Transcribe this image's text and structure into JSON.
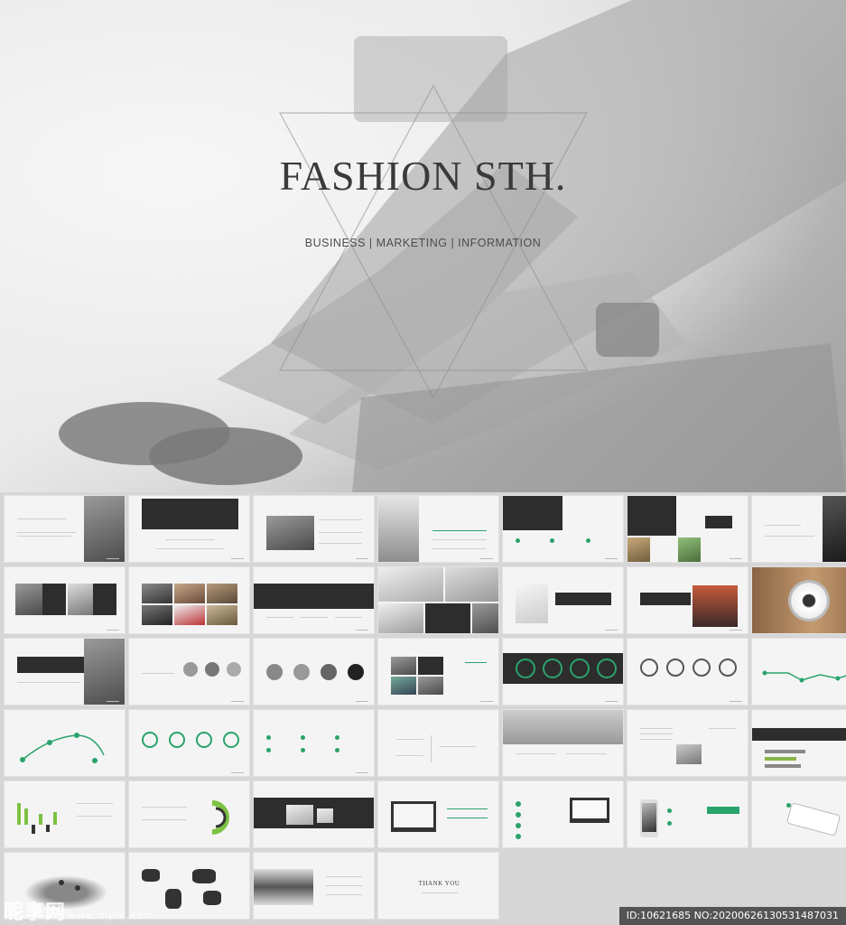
{
  "hero": {
    "title": "FASHION STH.",
    "subtitle": "BUSINESS | MARKETING | INFORMATION"
  },
  "slides": {
    "thank_you": "THANK YOU"
  },
  "watermark": {
    "logo": "昵享网",
    "logo_url": "www.nipic.com",
    "id_text": "ID:10621685 NO:20200626130531487031"
  },
  "colors": {
    "accent_green": "#2aa36c",
    "dark_band": "#2d2d2d",
    "background": "#d6d6d6"
  }
}
